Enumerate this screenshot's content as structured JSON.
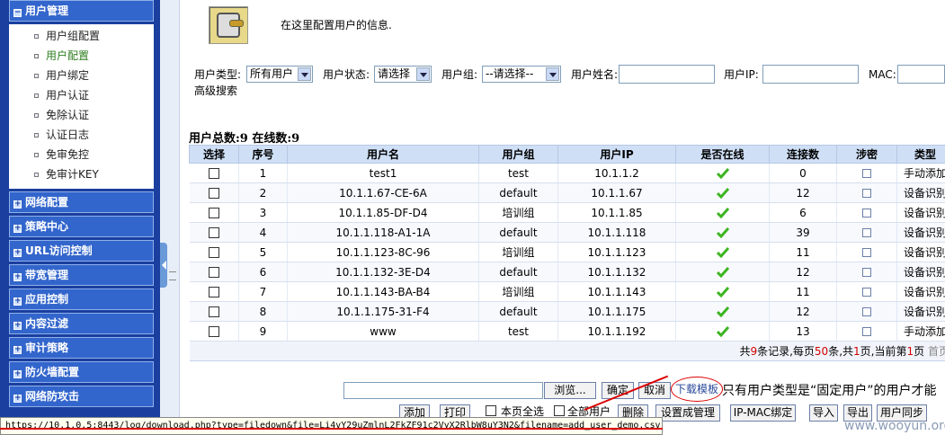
{
  "sidebar": {
    "expanded": {
      "label": "用户管理"
    },
    "sub_items": [
      {
        "label": "用户组配置",
        "active": false
      },
      {
        "label": "用户配置",
        "active": true
      },
      {
        "label": "用户绑定",
        "active": false
      },
      {
        "label": "用户认证",
        "active": false
      },
      {
        "label": "免除认证",
        "active": false
      },
      {
        "label": "认证日志",
        "active": false
      },
      {
        "label": "免审免控",
        "active": false
      },
      {
        "label": "免审计KEY",
        "active": false
      }
    ],
    "sections": [
      "网络配置",
      "策略中心",
      "URL访问控制",
      "带宽管理",
      "应用控制",
      "内容过滤",
      "审计策略",
      "防火墙配置",
      "网络防攻击"
    ]
  },
  "header": {
    "description": "在这里配置用户的信息."
  },
  "filters": {
    "user_type_label": "用户类型:",
    "user_type_value": "所有用户",
    "user_status_label": "用户状态:",
    "user_status_value": "请选择",
    "user_group_label": "用户组:",
    "user_group_value": "--请选择--",
    "user_name_label": "用户姓名:",
    "user_ip_label": "用户IP:",
    "mac_label": "MAC:",
    "advanced_search": "高级搜索"
  },
  "summary": "用户总数:9 在线数:9",
  "table": {
    "headers": [
      "选择",
      "序号",
      "用户名",
      "用户组",
      "用户IP",
      "是否在线",
      "连接数",
      "涉密",
      "类型"
    ],
    "rows": [
      {
        "seq": "1",
        "username": "test1",
        "group": "test",
        "ip": "10.1.1.2",
        "connections": "0",
        "type": "手动添加"
      },
      {
        "seq": "2",
        "username": "10.1.1.67-CE-6A",
        "group": "default",
        "ip": "10.1.1.67",
        "connections": "12",
        "type": "设备识别"
      },
      {
        "seq": "3",
        "username": "10.1.1.85-DF-D4",
        "group": "培训组",
        "ip": "10.1.1.85",
        "connections": "6",
        "type": "设备识别"
      },
      {
        "seq": "4",
        "username": "10.1.1.118-A1-1A",
        "group": "default",
        "ip": "10.1.1.118",
        "connections": "39",
        "type": "设备识别"
      },
      {
        "seq": "5",
        "username": "10.1.1.123-8C-96",
        "group": "培训组",
        "ip": "10.1.1.123",
        "connections": "11",
        "type": "设备识别"
      },
      {
        "seq": "6",
        "username": "10.1.1.132-3E-D4",
        "group": "default",
        "ip": "10.1.1.132",
        "connections": "12",
        "type": "设备识别"
      },
      {
        "seq": "7",
        "username": "10.1.1.143-BA-B4",
        "group": "培训组",
        "ip": "10.1.1.143",
        "connections": "11",
        "type": "设备识别"
      },
      {
        "seq": "8",
        "username": "10.1.1.175-31-F4",
        "group": "default",
        "ip": "10.1.1.175",
        "connections": "12",
        "type": "设备识别"
      },
      {
        "seq": "9",
        "username": "www",
        "group": "test",
        "ip": "10.1.1.192",
        "connections": "13",
        "type": "手动添加"
      }
    ],
    "pager": {
      "p1": "共",
      "total": "9",
      "p2": "条记录,每页",
      "per_page": "50",
      "p3": "条,共",
      "pages": "1",
      "p4": "页,当前第",
      "current": "1",
      "p5": "页",
      "first": "首页"
    }
  },
  "import": {
    "browse": "浏览...",
    "confirm": "确定",
    "cancel": "取消",
    "download_template": "下载模板",
    "note": "只有用户类型是“固定用户”的用户才能"
  },
  "actions": {
    "add": "添加",
    "print": "打印",
    "select_page": "本页全选",
    "all_users": "全部用户",
    "delete": "删除",
    "set_admin": "设置成管理",
    "ipmac_bind": "IP-MAC绑定",
    "import": "导入",
    "export": "导出",
    "sync": "用户同步"
  },
  "status_bar": "https://10.1.0.5:8443/log/download.php?type=filedown&file=Li4vY29uZmlnL2FkZF91c2VyX2RlbW8uY3N2&filename=add_user_demo.csv",
  "watermark": "www.wooyun.org",
  "colors": {
    "sidebar_bg": "#1a3f9f",
    "header_row": "#cfdff6",
    "online_check": "#3cb521",
    "pager_red": "#d40000"
  }
}
